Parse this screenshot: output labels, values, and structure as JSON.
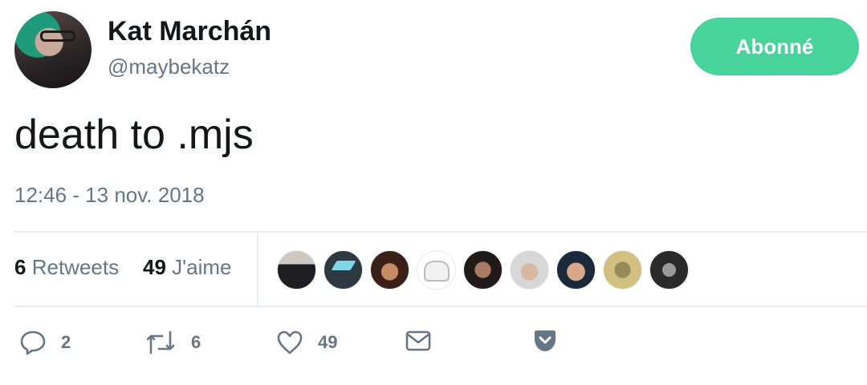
{
  "user": {
    "display_name": "Kat Marchán",
    "handle": "@maybekatz"
  },
  "follow_button": {
    "label": "Abonné",
    "color": "#47d39a"
  },
  "tweet": {
    "text": "death to .mjs",
    "timestamp": "12:46 - 13 nov. 2018"
  },
  "stats": {
    "retweets_count": "6",
    "retweets_label": "Retweets",
    "likes_count": "49",
    "likes_label": "J'aime"
  },
  "likers_count_shown": 9,
  "actions": {
    "reply_count": "2",
    "retweet_count": "6",
    "like_count": "49"
  },
  "icons": {
    "reply": "reply-icon",
    "retweet": "retweet-icon",
    "like": "heart-icon",
    "dm": "envelope-icon",
    "pocket": "pocket-icon"
  },
  "colors": {
    "secondary_text": "#657786",
    "primary_text": "#14171a",
    "divider": "#e6ecf0"
  }
}
